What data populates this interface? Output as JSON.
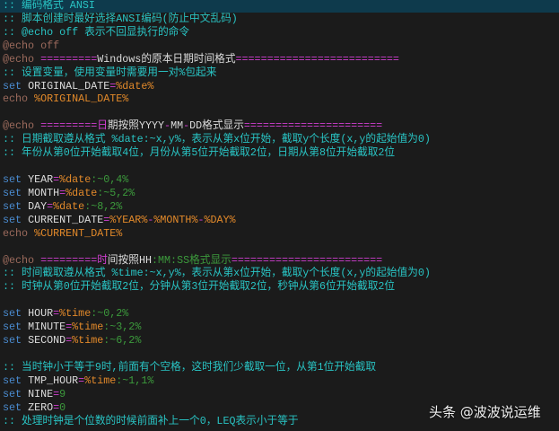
{
  "editor": {
    "current_line": 0,
    "colors": {
      "comment": "#29c4c4",
      "echo": "#9b6a5c",
      "keyword": "#4a8bd0",
      "text": "#dcdcdc",
      "operator": "#d23fd2",
      "variable": "#e2892a",
      "substring": "#3c9a3c",
      "background": "#1b1b1b"
    },
    "lines": [
      [
        [
          "c",
          ":: 编码格式 ANSI"
        ]
      ],
      [
        [
          "c",
          ":: 脚本创建时最好选择ANSI编码(防止中文乱码)"
        ]
      ],
      [
        [
          "c",
          ":: @echo off 表示不回显执行的命令"
        ]
      ],
      [
        [
          "e",
          "@echo off"
        ]
      ],
      [
        [
          "e",
          "@echo "
        ],
        [
          "p",
          "========="
        ],
        [
          "w",
          "Windows的原本日期时间格式"
        ],
        [
          "p",
          "=========================="
        ]
      ],
      [
        [
          "c",
          ":: 设置变量，使用变量时需要用一对%包起来"
        ]
      ],
      [
        [
          "k",
          "set "
        ],
        [
          "w",
          "ORIGINAL_DATE"
        ],
        [
          "p",
          "="
        ],
        [
          "o",
          "%date%"
        ]
      ],
      [
        [
          "e",
          "echo "
        ],
        [
          "o",
          "%ORIGINAL_DATE%"
        ]
      ],
      [],
      [
        [
          "e",
          "@echo "
        ],
        [
          "p",
          "========="
        ],
        [
          "p",
          "日"
        ],
        [
          "w",
          "期按照YYYY"
        ],
        [
          "p",
          "-"
        ],
        [
          "w",
          "MM"
        ],
        [
          "p",
          "-"
        ],
        [
          "w",
          "DD格式显示"
        ],
        [
          "p",
          "======================"
        ]
      ],
      [
        [
          "c",
          ":: 日期截取遵从格式 %date:~x,y%，表示从第x位开始，截取y个长度(x,y的起始值为0)"
        ]
      ],
      [
        [
          "c",
          ":: 年份从第0位开始截取4位，月份从第5位开始截取2位，日期从第8位开始截取2位"
        ]
      ],
      [],
      [
        [
          "k",
          "set "
        ],
        [
          "w",
          "YEAR"
        ],
        [
          "p",
          "="
        ],
        [
          "o",
          "%date"
        ],
        [
          "g",
          ":~0,4%"
        ]
      ],
      [
        [
          "k",
          "set "
        ],
        [
          "w",
          "MONTH"
        ],
        [
          "p",
          "="
        ],
        [
          "o",
          "%date"
        ],
        [
          "g",
          ":~5,2%"
        ]
      ],
      [
        [
          "k",
          "set "
        ],
        [
          "w",
          "DAY"
        ],
        [
          "p",
          "="
        ],
        [
          "o",
          "%date"
        ],
        [
          "g",
          ":~8,2%"
        ]
      ],
      [
        [
          "k",
          "set "
        ],
        [
          "w",
          "CURRENT_DATE"
        ],
        [
          "p",
          "="
        ],
        [
          "o",
          "%YEAR%"
        ],
        [
          "p",
          "-"
        ],
        [
          "o",
          "%MONTH%"
        ],
        [
          "p",
          "-"
        ],
        [
          "o",
          "%DAY%"
        ]
      ],
      [
        [
          "e",
          "echo "
        ],
        [
          "o",
          "%CURRENT_DATE%"
        ]
      ],
      [],
      [
        [
          "e",
          "@echo "
        ],
        [
          "p",
          "========="
        ],
        [
          "p",
          "时"
        ],
        [
          "w",
          "间按照HH"
        ],
        [
          "g",
          ":MM:SS格式显示"
        ],
        [
          "p",
          "========================"
        ]
      ],
      [
        [
          "c",
          ":: 时间截取遵从格式 %time:~x,y%，表示从第x位开始，截取y个长度(x,y的起始值为0)"
        ]
      ],
      [
        [
          "c",
          ":: 时钟从第0位开始截取2位，分钟从第3位开始截取2位，秒钟从第6位开始截取2位"
        ]
      ],
      [],
      [
        [
          "k",
          "set "
        ],
        [
          "w",
          "HOUR"
        ],
        [
          "p",
          "="
        ],
        [
          "o",
          "%time"
        ],
        [
          "g",
          ":~0,2%"
        ]
      ],
      [
        [
          "k",
          "set "
        ],
        [
          "w",
          "MINUTE"
        ],
        [
          "p",
          "="
        ],
        [
          "o",
          "%time"
        ],
        [
          "g",
          ":~3,2%"
        ]
      ],
      [
        [
          "k",
          "set "
        ],
        [
          "w",
          "SECOND"
        ],
        [
          "p",
          "="
        ],
        [
          "o",
          "%time"
        ],
        [
          "g",
          ":~6,2%"
        ]
      ],
      [],
      [
        [
          "c",
          ":: 当时钟小于等于9时,前面有个空格，这时我们少截取一位，从第1位开始截取"
        ]
      ],
      [
        [
          "k",
          "set "
        ],
        [
          "w",
          "TMP_HOUR"
        ],
        [
          "p",
          "="
        ],
        [
          "o",
          "%time"
        ],
        [
          "g",
          ":~1,1%"
        ]
      ],
      [
        [
          "k",
          "set "
        ],
        [
          "w",
          "NINE"
        ],
        [
          "p",
          "="
        ],
        [
          "g",
          "9"
        ]
      ],
      [
        [
          "k",
          "set "
        ],
        [
          "w",
          "ZERO"
        ],
        [
          "p",
          "="
        ],
        [
          "g",
          "0"
        ]
      ],
      [
        [
          "c",
          ":: 处理时钟是个位数的时候前面补上一个0，LEQ表示小于等于"
        ]
      ]
    ]
  },
  "watermark": "头条 @波波说运维"
}
